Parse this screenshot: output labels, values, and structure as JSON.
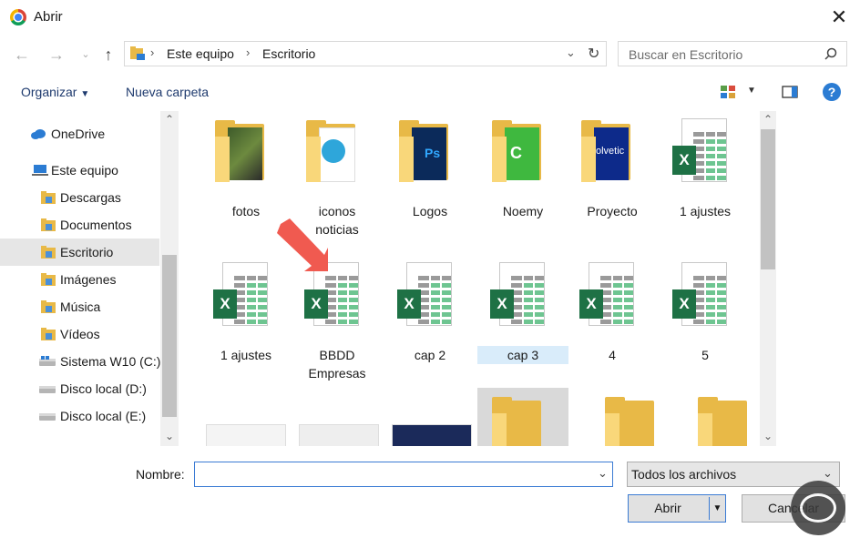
{
  "window": {
    "title": "Abrir"
  },
  "address": {
    "crumbs": [
      "Este equipo",
      "Escritorio"
    ]
  },
  "search": {
    "placeholder": "Buscar en Escritorio"
  },
  "toolbar": {
    "organize_label": "Organizar",
    "new_folder_label": "Nueva carpeta"
  },
  "nav": {
    "items": [
      {
        "label": "OneDrive",
        "icon": "cloud-icon"
      },
      {
        "label": "Este equipo",
        "icon": "computer-icon"
      },
      {
        "label": "Descargas",
        "icon": "downloads-folder-icon"
      },
      {
        "label": "Documentos",
        "icon": "documents-folder-icon"
      },
      {
        "label": "Escritorio",
        "icon": "desktop-folder-icon",
        "selected": true
      },
      {
        "label": "Imágenes",
        "icon": "pictures-folder-icon"
      },
      {
        "label": "Música",
        "icon": "music-folder-icon"
      },
      {
        "label": "Vídeos",
        "icon": "videos-folder-icon"
      },
      {
        "label": "Sistema W10 (C:)",
        "icon": "windows-drive-icon"
      },
      {
        "label": "Disco local (D:)",
        "icon": "drive-icon"
      },
      {
        "label": "Disco local (E:)",
        "icon": "drive-icon"
      }
    ]
  },
  "files": {
    "row1": [
      {
        "name": "fotos",
        "kind": "folder",
        "art": "photo"
      },
      {
        "name": "iconos\nnoticias",
        "kind": "folder",
        "art": "telegram"
      },
      {
        "name": "Logos",
        "kind": "folder",
        "art": "photoshop"
      },
      {
        "name": "Noemy",
        "kind": "folder",
        "art": "camtasia"
      },
      {
        "name": "Proyecto",
        "kind": "folder",
        "art": "solvetic"
      },
      {
        "name": "1 ajustes",
        "kind": "excel"
      }
    ],
    "row2": [
      {
        "name": "1 ajustes",
        "kind": "excel"
      },
      {
        "name": "BBDD\nEmpresas",
        "kind": "excel"
      },
      {
        "name": "cap 2",
        "kind": "excel"
      },
      {
        "name": "cap 3",
        "kind": "excel",
        "selected": true
      },
      {
        "name": "4",
        "kind": "excel"
      },
      {
        "name": "5",
        "kind": "excel"
      }
    ]
  },
  "footer": {
    "name_label": "Nombre:",
    "name_value": "",
    "type_value": "Todos los archivos",
    "open_label": "Abrir",
    "cancel_label": "Cancelar"
  },
  "colors": {
    "accent": "#3b7bd4",
    "excel": "#1e7145",
    "folder": "#e8b947",
    "link": "#1e3a6e",
    "annotation_arrow": "#f05a50"
  }
}
